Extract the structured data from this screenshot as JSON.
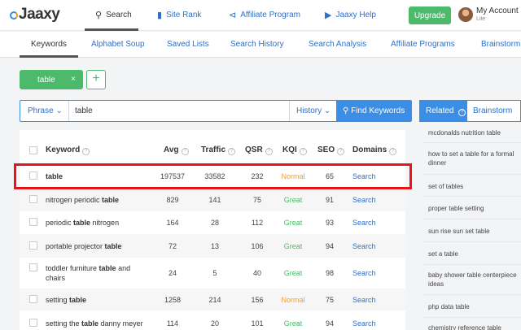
{
  "brand": {
    "logo_text": "Jaaxy"
  },
  "topnav": [
    {
      "label": "Search",
      "icon": "search-icon",
      "active": true
    },
    {
      "label": "Site Rank",
      "icon": "bar-chart-icon",
      "active": false
    },
    {
      "label": "Affiliate Program",
      "icon": "share-icon",
      "active": false
    },
    {
      "label": "Jaaxy Help",
      "icon": "play-circle-icon",
      "active": false
    }
  ],
  "upgrade_label": "Upgrade",
  "account": {
    "name": "My Account",
    "plan": "Lite"
  },
  "subnav": [
    "Keywords",
    "Alphabet Soup",
    "Saved Lists",
    "Search History",
    "Search Analysis",
    "Affiliate Programs",
    "Brainstorm"
  ],
  "chip": {
    "label": "table",
    "remove": "×",
    "add": "+"
  },
  "search": {
    "mode": "Phrase",
    "value": "table",
    "history_label": "History",
    "button_label": "Find Keywords"
  },
  "table": {
    "headers": {
      "keyword": "Keyword",
      "avg": "Avg",
      "traffic": "Traffic",
      "qsr": "QSR",
      "kqi": "KQI",
      "seo": "SEO",
      "domains": "Domains"
    },
    "rows": [
      {
        "kw_pre": "",
        "kw_bold": "table",
        "kw_post": "",
        "avg": "197537",
        "traffic": "33582",
        "qsr": "232",
        "kqi": "Normal",
        "seo": "65",
        "domains": "Search"
      },
      {
        "kw_pre": "nitrogen periodic ",
        "kw_bold": "table",
        "kw_post": "",
        "avg": "829",
        "traffic": "141",
        "qsr": "75",
        "kqi": "Great",
        "seo": "91",
        "domains": "Search"
      },
      {
        "kw_pre": "periodic ",
        "kw_bold": "table",
        "kw_post": " nitrogen",
        "avg": "164",
        "traffic": "28",
        "qsr": "112",
        "kqi": "Great",
        "seo": "93",
        "domains": "Search"
      },
      {
        "kw_pre": "portable projector ",
        "kw_bold": "table",
        "kw_post": "",
        "avg": "72",
        "traffic": "13",
        "qsr": "106",
        "kqi": "Great",
        "seo": "94",
        "domains": "Search"
      },
      {
        "kw_pre": "toddler furniture ",
        "kw_bold": "table",
        "kw_post": " and",
        "kw_line2": "chairs",
        "avg": "24",
        "traffic": "5",
        "qsr": "40",
        "kqi": "Great",
        "seo": "98",
        "domains": "Search"
      },
      {
        "kw_pre": "setting ",
        "kw_bold": "table",
        "kw_post": "",
        "avg": "1258",
        "traffic": "214",
        "qsr": "156",
        "kqi": "Normal",
        "seo": "75",
        "domains": "Search"
      },
      {
        "kw_pre": "setting the ",
        "kw_bold": "table",
        "kw_post": " danny meyer",
        "avg": "114",
        "traffic": "20",
        "qsr": "101",
        "kqi": "Great",
        "seo": "94",
        "domains": "Search"
      }
    ]
  },
  "related": {
    "tabs": {
      "related": "Related",
      "brainstorm": "Brainstorm"
    },
    "items": [
      "mcdonalds nutrition table",
      "how to set a table for a formal dinner",
      "set of tables",
      "proper table setting",
      "sun rise sun set table",
      "set a table",
      "baby shower table centerpiece ideas",
      "php data table",
      "chemistry reference table"
    ]
  }
}
